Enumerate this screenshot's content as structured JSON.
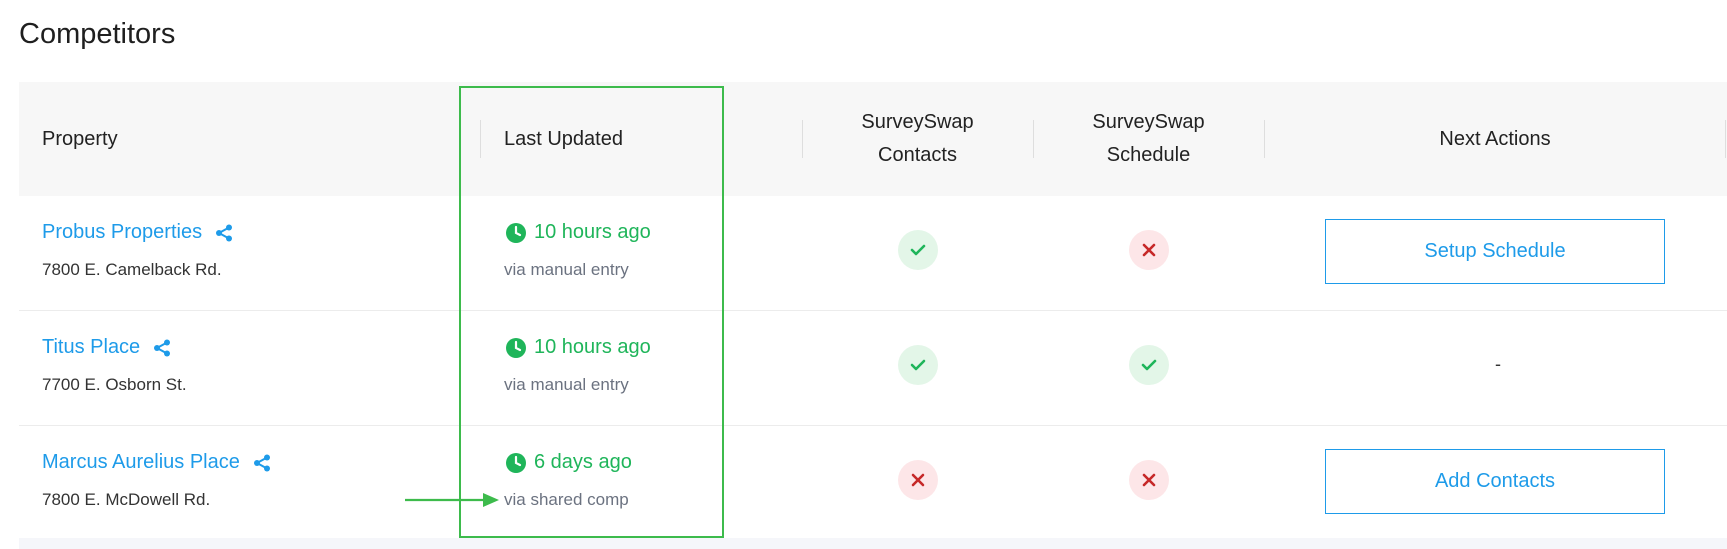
{
  "page": {
    "title": "Competitors"
  },
  "table": {
    "headers": {
      "property": "Property",
      "last_updated": "Last Updated",
      "contacts_line1": "SurveySwap",
      "contacts_line2": "Contacts",
      "schedule_line1": "SurveySwap",
      "schedule_line2": "Schedule",
      "next_actions": "Next Actions"
    },
    "rows": [
      {
        "name": "Probus Properties",
        "address": "7800 E. Camelback Rd.",
        "updated": "10 hours ago",
        "via": "via manual entry",
        "contacts": "check-icon",
        "schedule": "x-icon",
        "action": "Setup Schedule"
      },
      {
        "name": "Titus Place",
        "address": "7700 E. Osborn St.",
        "updated": "10 hours ago",
        "via": "via manual entry",
        "contacts": "check-icon",
        "schedule": "check-icon",
        "action": "-"
      },
      {
        "name": "Marcus Aurelius Place",
        "address": "7800 E. McDowell Rd.",
        "updated": "6 days ago",
        "via": "via shared comp",
        "contacts": "x-icon",
        "schedule": "x-icon",
        "action": "Add Contacts"
      }
    ]
  },
  "colors": {
    "link": "#1e9be9",
    "success": "#1fb55a",
    "danger": "#c62828",
    "highlight": "#3dbb4c"
  }
}
